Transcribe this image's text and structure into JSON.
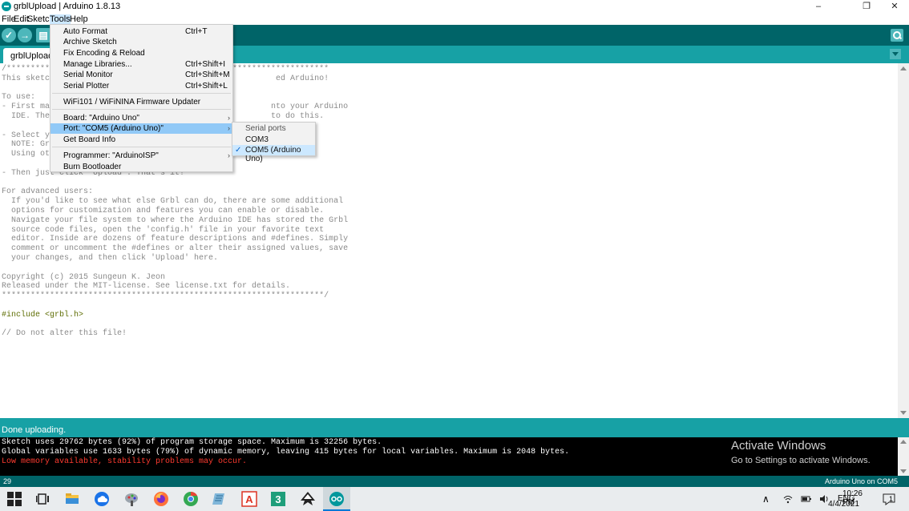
{
  "window": {
    "title": "grblUpload | Arduino 1.8.13",
    "min_icon": "minimize-icon",
    "max_icon": "restore-icon",
    "close_icon": "close-icon",
    "min_glyph": "–",
    "max_glyph": "❐",
    "close_glyph": "✕"
  },
  "menubar": {
    "file": "File",
    "edit": "Edit",
    "sketch": "Sketch",
    "tools": "Tools",
    "help": "Help"
  },
  "toolbar": {
    "verify_glyph": "✓",
    "upload_glyph": "→",
    "new_glyph": "▤"
  },
  "tab": {
    "label": "grblUpload"
  },
  "tools_menu": {
    "items": [
      {
        "label": "Auto Format",
        "shortcut": "Ctrl+T"
      },
      {
        "label": "Archive Sketch",
        "shortcut": ""
      },
      {
        "label": "Fix Encoding & Reload",
        "shortcut": ""
      },
      {
        "label": "Manage Libraries...",
        "shortcut": "Ctrl+Shift+I"
      },
      {
        "label": "Serial Monitor",
        "shortcut": "Ctrl+Shift+M"
      },
      {
        "label": "Serial Plotter",
        "shortcut": "Ctrl+Shift+L"
      },
      {
        "label": "WiFi101 / WiFiNINA Firmware Updater",
        "shortcut": ""
      },
      {
        "label": "Board: \"Arduino Uno\"",
        "shortcut": ""
      },
      {
        "label": "Port: \"COM5 (Arduino Uno)\"",
        "shortcut": ""
      },
      {
        "label": "Get Board Info",
        "shortcut": ""
      },
      {
        "label": "Programmer: \"ArduinoISP\"",
        "shortcut": ""
      },
      {
        "label": "Burn Bootloader",
        "shortcut": ""
      }
    ],
    "submenu_arrow": "›"
  },
  "port_menu": {
    "header": "Serial ports",
    "items": [
      "COM3",
      "COM5 (Arduino Uno)"
    ],
    "selected": "COM5 (Arduino Uno)",
    "check_glyph": "✓"
  },
  "editor": {
    "lines": [
      "/*******************************************************************",
      "This sketch                                              ed Arduino!",
      "",
      "To use:",
      "- First mak                                             nto your Arduino",
      "  IDE. Ther                                             to do this.",
      "",
      "- Select yo",
      "  NOTE: Grb",
      "  Using oth",
      "",
      "- Then just click 'Upload'. That's it!",
      "",
      "For advanced users:",
      "  If you'd like to see what else Grbl can do, there are some additional",
      "  options for customization and features you can enable or disable.",
      "  Navigate your file system to where the Arduino IDE has stored the Grbl",
      "  source code files, open the 'config.h' file in your favorite text",
      "  editor. Inside are dozens of feature descriptions and #defines. Simply",
      "  comment or uncomment the #defines or alter their assigned values, save",
      "  your changes, and then click 'Upload' here.",
      "",
      "Copyright (c) 2015 Sungeun K. Jeon",
      "Released under the MIT-license. See license.txt for details.",
      "*******************************************************************/",
      "",
      "#include <grbl.h>",
      "",
      "// Do not alter this file!"
    ]
  },
  "status": {
    "text": "Done uploading."
  },
  "console": {
    "lines": [
      {
        "text": "Sketch uses 29762 bytes (92%) of program storage space. Maximum is 32256 bytes.",
        "error": false
      },
      {
        "text": "Global variables use 1633 bytes (79%) of dynamic memory, leaving 415 bytes for local variables. Maximum is 2048 bytes.",
        "error": false
      },
      {
        "text": "Low memory available, stability problems may occur.",
        "error": true
      }
    ]
  },
  "watermark": {
    "title": "Activate Windows",
    "subtitle": "Go to Settings to activate Windows."
  },
  "infobar": {
    "line": "29",
    "board": "Arduino Uno on COM5"
  },
  "taskbar": {
    "time": "10:26 PM",
    "date": "4/4/2021",
    "lang": "ENG",
    "notify_count": "1"
  }
}
